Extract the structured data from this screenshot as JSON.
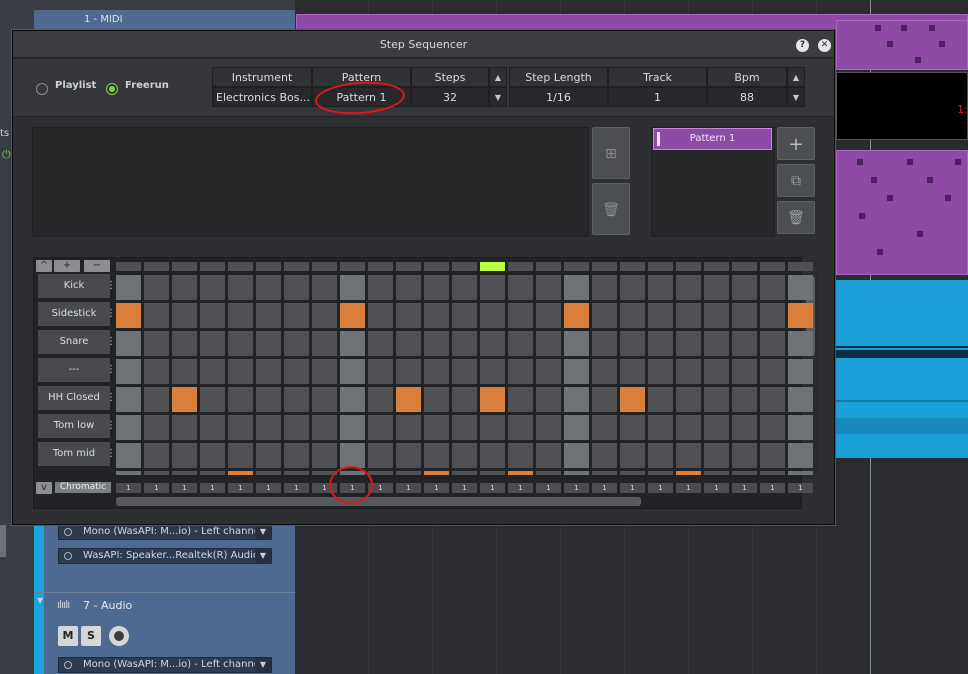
{
  "background": {
    "top_track_name": "1 - MIDI",
    "side_text_partial": "ts",
    "tracks": [
      {
        "io_channel": "Mono (WasAPI: M...io) - Left channel"
      },
      {
        "io_output": "WasAPI: Speaker...Realtek(R) Audio)"
      }
    ],
    "audio_track": {
      "name": "7 - Audio",
      "mute_label": "M",
      "solo_label": "S",
      "io_channel": "Mono (WasAPI: M...io) - Left channel"
    },
    "timecode_partial": "1:"
  },
  "dialog": {
    "title": "Step Sequencer",
    "help_label": "?",
    "close_label": "✕",
    "modes": [
      {
        "label": "Playlist",
        "selected": false
      },
      {
        "label": "Freerun",
        "selected": true
      }
    ],
    "table": {
      "headers": [
        "Instrument",
        "Pattern",
        "Steps",
        "Step Length",
        "Track",
        "Bpm"
      ],
      "values": [
        "Electronics Bos...",
        "Pattern 1",
        "32",
        "1/16",
        "1",
        "88"
      ]
    },
    "patterns": [
      "Pattern 1"
    ],
    "instruments": [
      "Kick",
      "Sidestick",
      "Snare",
      "---",
      "HH Closed",
      "Tom low",
      "Tom mid"
    ],
    "accent_value": "1",
    "chromatic_label": "Chromatic",
    "ctl_up": "^",
    "ctl_plus": "+",
    "ctl_minus": "−",
    "ctl_down": "v",
    "playhead_step": 13,
    "steps_visible": 25,
    "active_steps": {
      "Sidestick": [
        0,
        8,
        16,
        24
      ],
      "HH Closed": [
        2,
        10,
        13,
        18
      ]
    },
    "partial_row_steps": [
      4,
      11,
      14,
      20
    ]
  },
  "colors": {
    "accent_green": "#82cc3d",
    "step_on": "#d9803f",
    "pattern_purple": "#8d4aa6",
    "annotation_red": "#e0161b"
  }
}
